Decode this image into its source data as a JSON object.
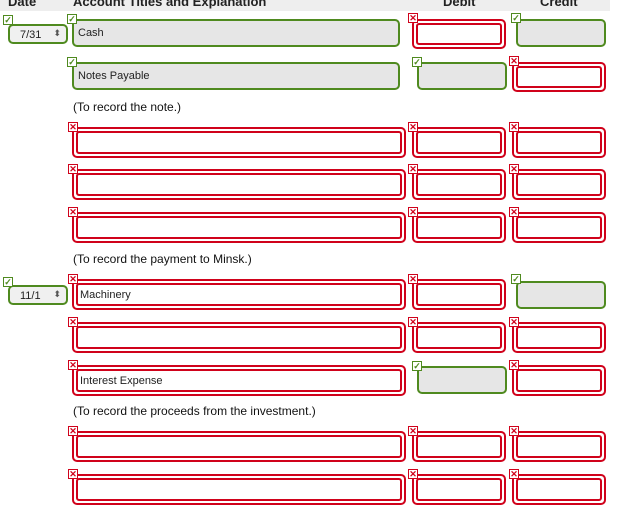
{
  "header": {
    "date": "Date",
    "account": "Account Titles and Explanation",
    "debit": "Debit",
    "credit": "Credit"
  },
  "dates": {
    "first": "7/31",
    "second": "11/1"
  },
  "accounts": {
    "cash": "Cash",
    "notes_payable": "Notes Payable",
    "machinery": "Machinery",
    "interest_expense": "Interest Expense"
  },
  "notes": {
    "record_note": "(To record the note.)",
    "record_payment": "(To record the payment to Minsk.)",
    "record_proceeds": "(To record the proceeds from the investment.)"
  },
  "icons": {
    "correct": "✓",
    "incorrect": "✕"
  },
  "colors": {
    "correct": "#4f8a1f",
    "incorrect": "#d0021b"
  }
}
